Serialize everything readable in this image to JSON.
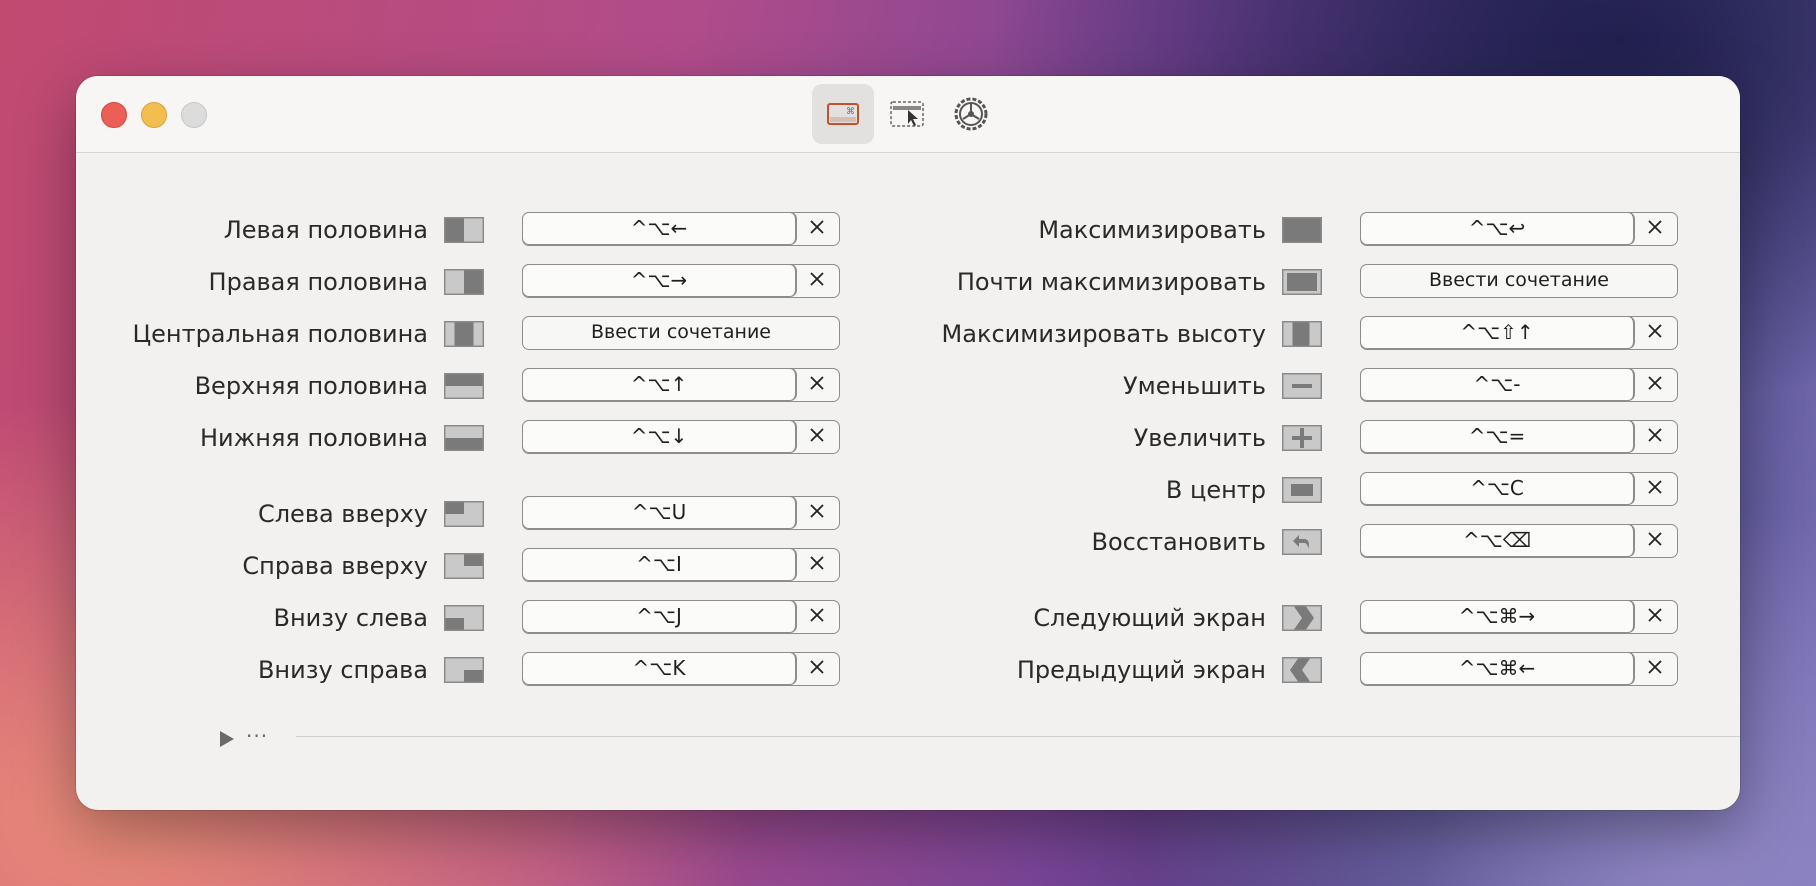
{
  "toolbar": {
    "tabs": [
      {
        "name": "shortcuts-tab",
        "icon": "keyboard-shortcut-icon",
        "active": true
      },
      {
        "name": "snap-areas-tab",
        "icon": "window-cursor-icon",
        "active": false
      },
      {
        "name": "settings-tab",
        "icon": "gear-icon",
        "active": false
      }
    ]
  },
  "left_rows": [
    {
      "label": "Левая половина",
      "shortcut": "^⌥←",
      "icon": "left-half-icon"
    },
    {
      "label": "Правая половина",
      "shortcut": "^⌥→",
      "icon": "right-half-icon"
    },
    {
      "label": "Центральная половина",
      "shortcut": "Ввести сочетание",
      "icon": "center-half-icon",
      "empty": true
    },
    {
      "label": "Верхняя половина",
      "shortcut": "^⌥↑",
      "icon": "top-half-icon"
    },
    {
      "label": "Нижняя половина",
      "shortcut": "^⌥↓",
      "icon": "bottom-half-icon"
    },
    {
      "label": "Слева вверху",
      "shortcut": "^⌥U",
      "icon": "top-left-icon"
    },
    {
      "label": "Справа вверху",
      "shortcut": "^⌥I",
      "icon": "top-right-icon"
    },
    {
      "label": "Внизу слева",
      "shortcut": "^⌥J",
      "icon": "bottom-left-icon"
    },
    {
      "label": "Внизу справа",
      "shortcut": "^⌥K",
      "icon": "bottom-right-icon"
    }
  ],
  "right_rows": [
    {
      "label": "Максимизировать",
      "shortcut": "^⌥↩",
      "icon": "maximize-icon"
    },
    {
      "label": "Почти максимизировать",
      "shortcut": "Ввести сочетание",
      "icon": "almost-maximize-icon",
      "empty": true
    },
    {
      "label": "Максимизировать высоту",
      "shortcut": "^⌥⇧↑",
      "icon": "maximize-height-icon"
    },
    {
      "label": "Уменьшить",
      "shortcut": "^⌥-",
      "icon": "minus-icon"
    },
    {
      "label": "Увеличить",
      "shortcut": "^⌥=",
      "icon": "plus-icon"
    },
    {
      "label": "В центр",
      "shortcut": "^⌥C",
      "icon": "center-icon"
    },
    {
      "label": "Восстановить",
      "shortcut": "^⌥⌫",
      "icon": "restore-icon"
    },
    {
      "label": "Следующий экран",
      "shortcut": "^⌥⌘→",
      "icon": "next-display-icon"
    },
    {
      "label": "Предыдущий экран",
      "shortcut": "^⌥⌘←",
      "icon": "previous-display-icon"
    }
  ],
  "footer": {
    "expand_icon": "play-triangle-icon",
    "dots": "···"
  }
}
